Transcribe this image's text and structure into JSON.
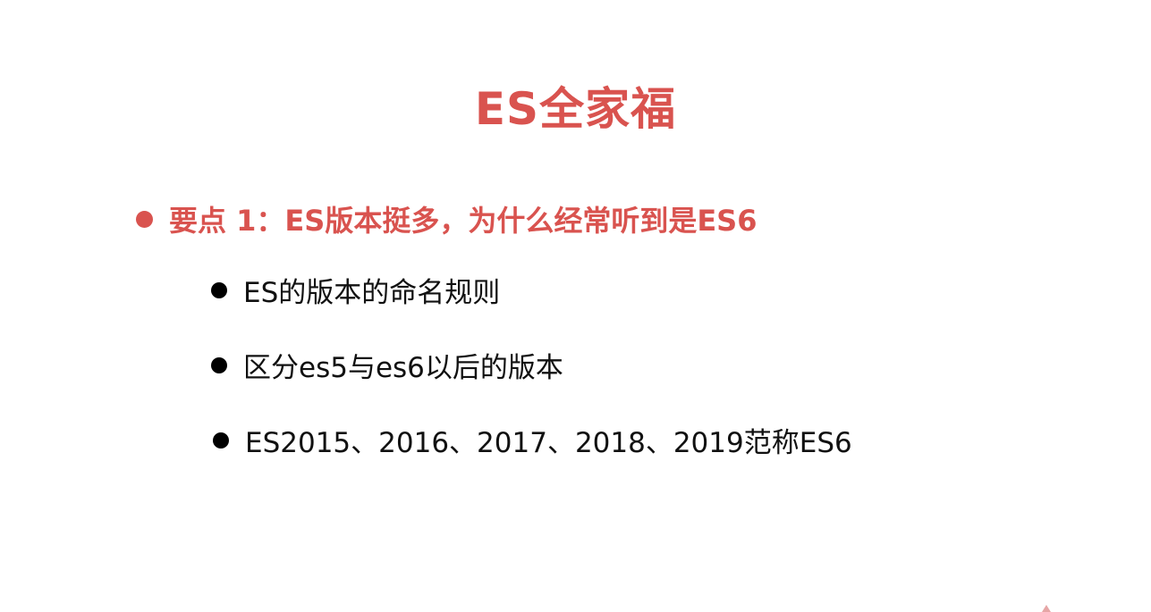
{
  "slide": {
    "title": "ES全家福",
    "main_point": "要点 1：ES版本挺多，为什么经常听到是ES6",
    "sub_points": [
      "ES的版本的命名规则",
      "区分es5与es6以后的版本",
      "ES2015、2016、2017、2018、2019范称ES6"
    ]
  },
  "colors": {
    "accent": "#d9534f",
    "text": "#111111",
    "background": "#ffffff"
  }
}
